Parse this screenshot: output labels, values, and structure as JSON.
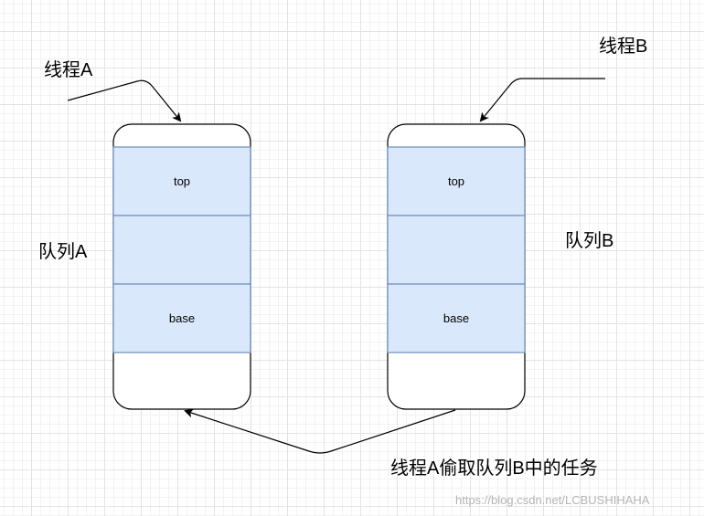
{
  "labels": {
    "thread_a": "线程A",
    "thread_b": "线程B",
    "queue_a": "队列A",
    "queue_b": "队列B",
    "steal_note": "线程A偷取队列B中的任务"
  },
  "queue_a": {
    "top_label": "top",
    "base_label": "base"
  },
  "queue_b": {
    "top_label": "top",
    "base_label": "base"
  },
  "watermark": "https://blog.csdn.net/LCBUSHIHAHA",
  "colors": {
    "cell_fill": "#dae8fc",
    "cell_stroke": "#6c8ebf",
    "outline": "#000000"
  }
}
